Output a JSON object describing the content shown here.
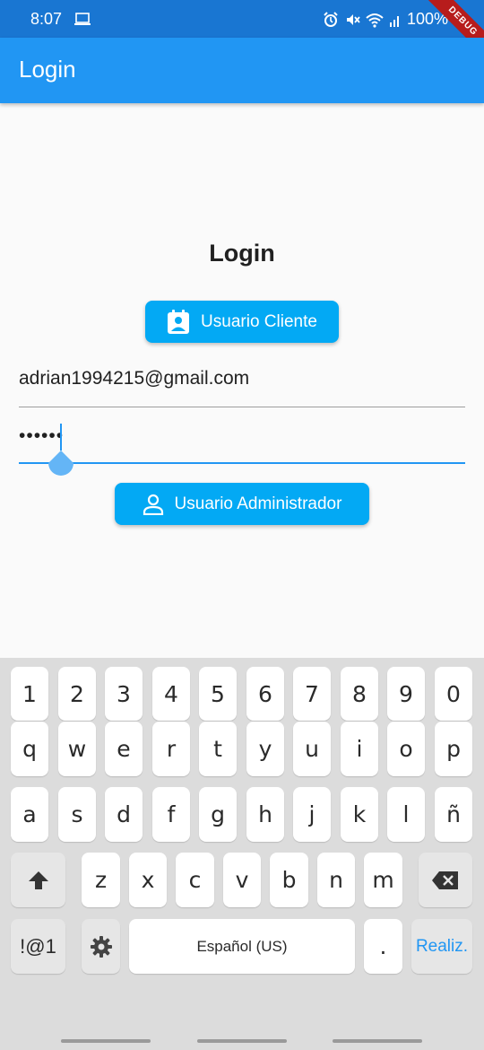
{
  "status_bar": {
    "time": "8:07",
    "battery": "100%",
    "debug_label": "DEBUG",
    "icons": [
      "laptop-icon",
      "alarm-icon",
      "mute-icon",
      "wifi-icon",
      "signal-icon"
    ]
  },
  "app_bar": {
    "title": "Login"
  },
  "form": {
    "heading": "Login",
    "cliente_button": "Usuario Cliente",
    "email_value": "adrian1994215@gmail.com",
    "password_value": "••••••",
    "admin_button": "Usuario Administrador"
  },
  "keyboard": {
    "row_numbers": [
      "1",
      "2",
      "3",
      "4",
      "5",
      "6",
      "7",
      "8",
      "9",
      "0"
    ],
    "row1": [
      "q",
      "w",
      "e",
      "r",
      "t",
      "y",
      "u",
      "i",
      "o",
      "p"
    ],
    "row2": [
      "a",
      "s",
      "d",
      "f",
      "g",
      "h",
      "j",
      "k",
      "l",
      "ñ"
    ],
    "row3": [
      "z",
      "x",
      "c",
      "v",
      "b",
      "n",
      "m"
    ],
    "symbols_key": "!@1",
    "space_label": "Español (US)",
    "period_key": ".",
    "done_key": "Realiz."
  },
  "colors": {
    "status_bar": "#1976d2",
    "app_bar": "#2196f3",
    "button": "#03a9f4"
  }
}
